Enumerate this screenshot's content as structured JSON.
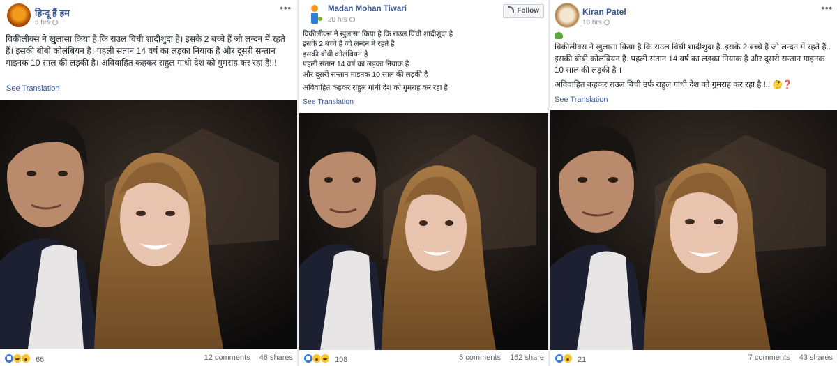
{
  "posts": [
    {
      "author": "हिन्दू हैं हम",
      "time": "5 hrs",
      "text": "विकीलीक्स ने खुलासा किया है कि राउल विंची शादीशुदा है। इसके 2 बच्चे हैं जो लन्दन में रहते हैं। इसकी बीबी कोलंबियन है। पहली संतान 14 वर्ष का लड़का नियाक है और दूसरी सन्तान माइनक 10 साल की लड़की है। अविवाहित कहकर राहुल गांधी देश को गुमराह कर रहा है!!!",
      "see_translation": "See Translation",
      "reaction_count": "66",
      "comments": "12 comments",
      "shares": "46 shares"
    },
    {
      "author": "Madan Mohan Tiwari",
      "time": "20 hrs",
      "follow_label": "Follow",
      "lines": [
        "विकीलीक्स ने खुलासा किया है कि राउल विंची शादीशुदा है",
        "इसके 2 बच्चे हैं जो लन्दन में रहते हैं",
        "इसकी बीबी कोलंबियन है",
        "पहली संतान 14 वर्ष का लड़का नियाक है",
        "और दूसरी सन्तान माइनक 10 साल की लड़की है",
        "",
        "अविवाहित कहकर राहुल गांधी देश को गुमराह कर रहा है"
      ],
      "see_translation": "See Translation",
      "reaction_count": "108",
      "comments": "5 comments",
      "shares": "162 share"
    },
    {
      "author": "Kiran Patel",
      "time": "18 hrs",
      "text": "विकीलीक्स ने खुलासा किया है कि राउल विंची शादीशुदा है..इसके 2 बच्चे हैं जो लन्दन में रहते हैं.. इसकी बीबी कोलंबियन है. पहली संतान 14 वर्ष का लड़का नियाक है और दूसरी सन्तान माइनक 10 साल की लड़की है ।",
      "text2": "अविवाहित कहकर राउल विंची उर्फ राहुल गांधी देश को गुमराह कर रहा है !!! 🤔❓",
      "see_translation": "See Translation",
      "reaction_count": "21",
      "comments": "7 comments",
      "shares": "43 shares"
    }
  ],
  "icons": {
    "more": "more-options-icon",
    "privacy": "globe-icon",
    "rss": "rss-icon"
  },
  "colors": {
    "link": "#385898",
    "meta": "#90949c",
    "like": "#3b7ae4",
    "haha": "#f7c52e"
  }
}
